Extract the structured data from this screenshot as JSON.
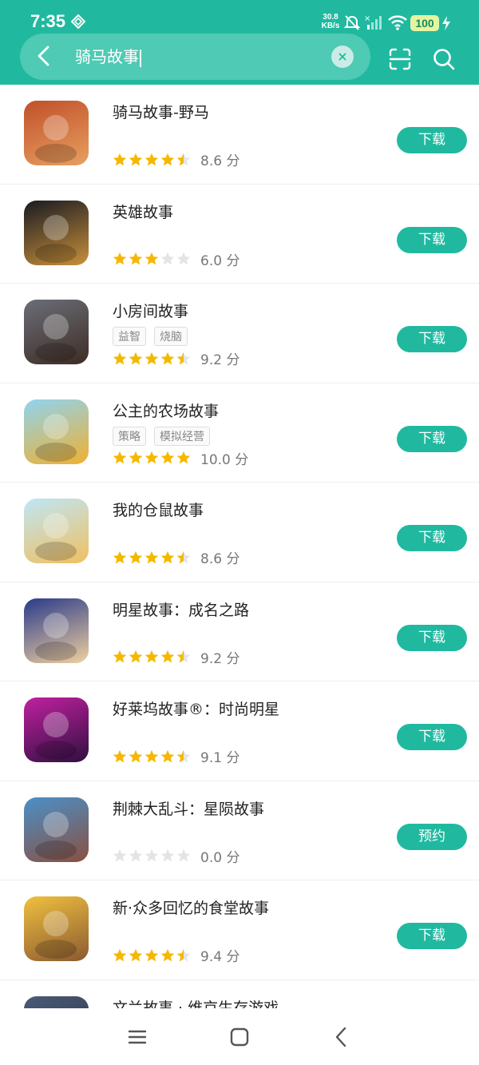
{
  "status": {
    "time": "7:35",
    "net_speed_value": "30.8",
    "net_speed_unit": "KB/s",
    "battery": "100"
  },
  "search": {
    "query": "骑马故事"
  },
  "apps": [
    {
      "name": "骑马故事-野马",
      "tags": [],
      "stars": 4.5,
      "score": "8.6 分",
      "action": "下载",
      "icon": "horse-riding-icon",
      "colors": [
        "#c0502a",
        "#e8a060"
      ]
    },
    {
      "name": "英雄故事",
      "tags": [],
      "stars": 3,
      "score": "6.0 分",
      "action": "下载",
      "icon": "fist-emblem-icon",
      "colors": [
        "#1a1a22",
        "#c8903a"
      ]
    },
    {
      "name": "小房间故事",
      "tags": [
        "益智",
        "烧脑"
      ],
      "stars": 4.5,
      "score": "9.2 分",
      "action": "下载",
      "icon": "room-icon",
      "colors": [
        "#6a6e78",
        "#3e2c24"
      ]
    },
    {
      "name": "公主的农场故事",
      "tags": [
        "策略",
        "模拟经营"
      ],
      "stars": 5,
      "score": "10.0 分",
      "action": "下载",
      "icon": "pixel-princess-icon",
      "colors": [
        "#8fd4f0",
        "#f0b030"
      ]
    },
    {
      "name": "我的仓鼠故事",
      "tags": [],
      "stars": 4.5,
      "score": "8.6 分",
      "action": "下载",
      "icon": "hamster-icon",
      "colors": [
        "#bfe6f5",
        "#f0c060"
      ]
    },
    {
      "name": "明星故事：成名之路",
      "tags": [],
      "stars": 4.5,
      "score": "9.2 分",
      "action": "下载",
      "icon": "star-girl-icon",
      "colors": [
        "#2a3a8a",
        "#f0d0a0"
      ]
    },
    {
      "name": "好莱坞故事®：时尚明星",
      "tags": [],
      "stars": 4.5,
      "score": "9.1 分",
      "action": "下载",
      "icon": "makeup-icon",
      "colors": [
        "#c020a0",
        "#301040"
      ]
    },
    {
      "name": "荆棘大乱斗：星陨故事",
      "tags": [],
      "stars": 0,
      "score": "0.0 分",
      "action": "预约",
      "icon": "monster-icon",
      "colors": [
        "#4a90c8",
        "#8a5040"
      ]
    },
    {
      "name": "新·众多回忆的食堂故事",
      "tags": [],
      "stars": 4.5,
      "score": "9.4 分",
      "action": "下载",
      "icon": "canteen-icon",
      "colors": [
        "#f0c040",
        "#8a5a30"
      ]
    }
  ],
  "partial_item": {
    "name": "文兰故事 · 维京生存游戏"
  },
  "colors": {
    "brand": "#20b9a0",
    "star_filled": "#f5b800",
    "star_empty": "#e4e4e4"
  }
}
